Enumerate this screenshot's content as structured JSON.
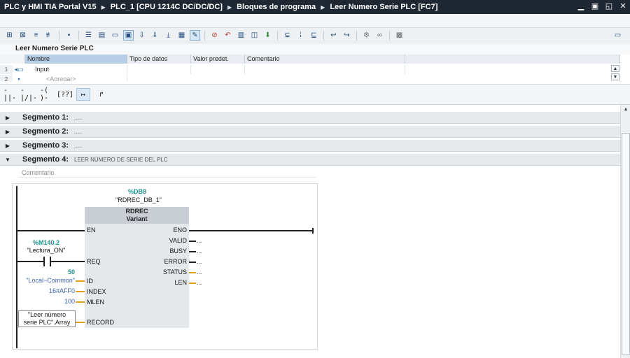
{
  "titlebar": {
    "crumbs": [
      "PLC y HMI TIA Portal V15",
      "PLC_1 [CPU 1214C DC/DC/DC]",
      "Bloques de programa",
      "Leer Numero Serie PLC [FC7]"
    ],
    "window_buttons": [
      "▁",
      "▣",
      "◱",
      "✕"
    ]
  },
  "toolbar": {
    "icons": [
      "insert-network-icon",
      "delete-network-icon",
      "insert-row-icon",
      "delete-row-icon",
      "go-to-icon",
      "list-view-icon",
      "table-icon",
      "block-icon",
      "comment-icon",
      "sort-down-icon",
      "sort-down-2-icon",
      "sort-down-3-icon",
      "grid-icon",
      "favorites-icon",
      "stop-icon",
      "jump-icon",
      "monitor-icon",
      "display-icon",
      "download-icon",
      "compare-icon",
      "edit-icon",
      "find-icon",
      "force-icon",
      "glasses-icon",
      "monitoring-icon",
      "binoculars-icon",
      "trace-icon"
    ],
    "right_icon": "settings-panel-icon"
  },
  "interface": {
    "title": "Leer Numero Serie PLC",
    "columns": [
      "Nombre",
      "Tipo de datos",
      "Valor predet.",
      "Comentario"
    ],
    "rows": [
      {
        "num": "1",
        "icon": "input-section-icon",
        "name": "Input"
      },
      {
        "num": "2",
        "icon": "add-icon",
        "name": "<Agregar>"
      }
    ]
  },
  "palette": {
    "items": [
      "-||-",
      "-|/|-",
      "-( )-",
      "[??]",
      "↦",
      "↱"
    ]
  },
  "segments": [
    {
      "label": "Segmento 1:",
      "desc": "....."
    },
    {
      "label": "Segmento 2:",
      "desc": "....."
    },
    {
      "label": "Segmento 3:",
      "desc": "....."
    },
    {
      "label": "Segmento 4:",
      "desc": "LEER NÚMERO DE SERIE DEL PLC"
    }
  ],
  "network": {
    "comment": "Comentario",
    "db_addr": "%DB8",
    "db_name": "\"RDREC_DB_1\"",
    "block_name": "RDREC",
    "block_type": "Variant",
    "pins_in": [
      "EN",
      "REQ",
      "ID",
      "INDEX",
      "MLEN",
      "RECORD"
    ],
    "pins_out": [
      "ENO",
      "VALID",
      "BUSY",
      "ERROR",
      "STATUS",
      "LEN"
    ],
    "req_addr": "%M140.2",
    "req_name": "\"Lectura_ON\"",
    "id_value": "50",
    "id_name": "\"Local~Common\"",
    "index_value": "16#AFF0",
    "mlen_value": "100",
    "record_line1": "\"Leer número",
    "record_line2": "serie PLC\".Array",
    "out_dots": "..."
  },
  "colors": {
    "title_bg": "#1f2733",
    "segment_bg": "#e6e9ec",
    "block_bg": "#e5e8eb",
    "operand_teal": "#1a8f8a",
    "constant_blue": "#3a5fa8",
    "param_wire": "#e0a020"
  }
}
